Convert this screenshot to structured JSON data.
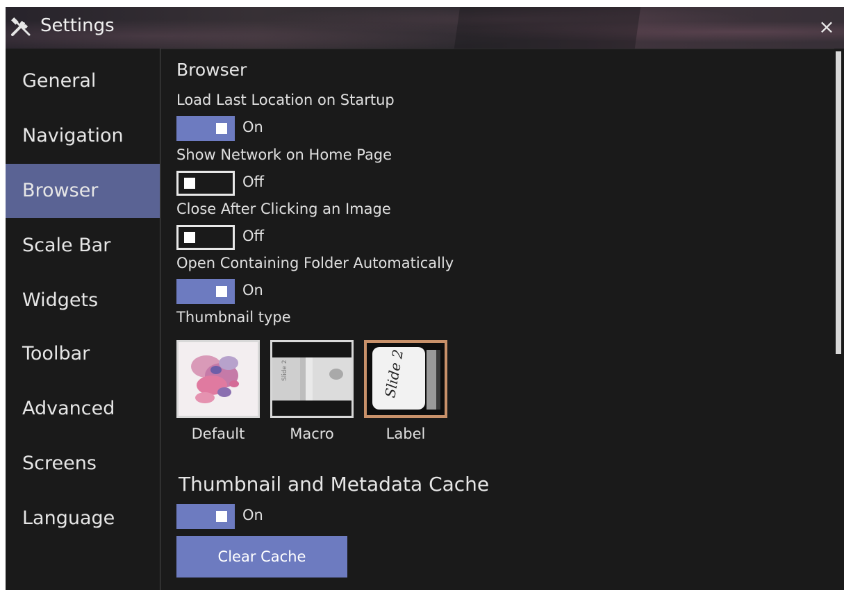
{
  "window": {
    "title": "Settings",
    "title_icon": "tools-icon",
    "close_glyph": "×"
  },
  "sidebar": {
    "items": [
      {
        "label": "General",
        "active": false
      },
      {
        "label": "Navigation",
        "active": false
      },
      {
        "label": "Browser",
        "active": true
      },
      {
        "label": "Scale Bar",
        "active": false
      },
      {
        "label": "Widgets",
        "active": false
      },
      {
        "label": "Toolbar",
        "active": false
      },
      {
        "label": "Advanced",
        "active": false
      },
      {
        "label": "Screens",
        "active": false
      },
      {
        "label": "Language",
        "active": false
      }
    ]
  },
  "browser": {
    "section_title": "Browser",
    "settings": [
      {
        "label": "Load Last Location on Startup",
        "state": "On"
      },
      {
        "label": "Show Network on Home Page",
        "state": "Off"
      },
      {
        "label": "Close After Clicking an Image",
        "state": "Off"
      },
      {
        "label": "Open Containing Folder Automatically",
        "state": "On"
      }
    ],
    "thumbnail_type": {
      "label": "Thumbnail type",
      "options": [
        {
          "label": "Default",
          "selected": false
        },
        {
          "label": "Macro",
          "selected": false
        },
        {
          "label": "Label",
          "selected": true
        }
      ]
    }
  },
  "cache": {
    "section_title": "Thumbnail and Metadata Cache",
    "state": "On",
    "clear_button": "Clear Cache"
  },
  "colors": {
    "accent": "#6d7bc0",
    "active_nav": "#5a6394",
    "selected_border": "#c8916a",
    "background": "#1a1a1a"
  }
}
